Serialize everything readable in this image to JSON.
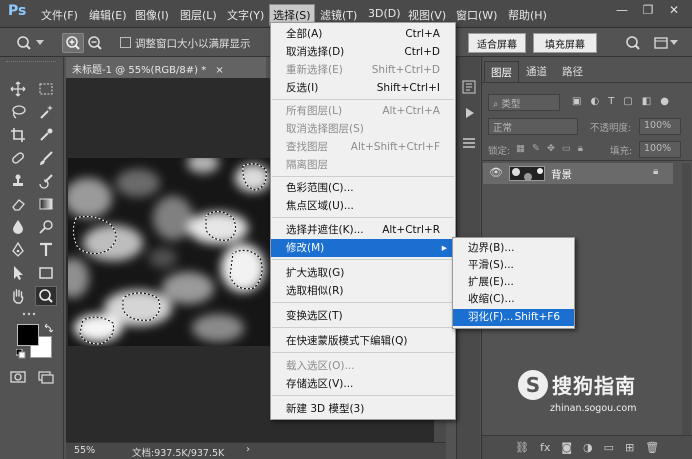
{
  "app": {
    "logo": "Ps"
  },
  "menubar": {
    "items": [
      "文件(F)",
      "编辑(E)",
      "图像(I)",
      "图层(L)",
      "文字(Y)",
      "选择(S)",
      "滤镜(T)",
      "3D(D)",
      "视图(V)",
      "窗口(W)",
      "帮助(H)"
    ],
    "active": "选择(S)",
    "window_controls": {
      "minimize": "—",
      "restore": "❐",
      "close": "✕"
    }
  },
  "options_bar": {
    "resize_window_label": "调整窗口大小以满屏显示",
    "fit_screen_label": "适合屏幕",
    "fill_screen_label": "填充屏幕"
  },
  "document": {
    "tab_title": "未标题-1 @ 55%(RGB/8#) *",
    "tab_close": "×",
    "zoom_level": "55%",
    "doc_info": "文档:937.5K/937.5K"
  },
  "select_menu": {
    "items": [
      {
        "label": "全部(A)",
        "shortcut": "Ctrl+A",
        "disabled": false
      },
      {
        "label": "取消选择(D)",
        "shortcut": "Ctrl+D",
        "disabled": false
      },
      {
        "label": "重新选择(E)",
        "shortcut": "Shift+Ctrl+D",
        "disabled": true
      },
      {
        "label": "反选(I)",
        "shortcut": "Shift+Ctrl+I",
        "disabled": false
      },
      {
        "label": "所有图层(L)",
        "shortcut": "Alt+Ctrl+A",
        "disabled": true
      },
      {
        "label": "取消选择图层(S)",
        "shortcut": "",
        "disabled": true
      },
      {
        "label": "查找图层",
        "shortcut": "Alt+Shift+Ctrl+F",
        "disabled": true
      },
      {
        "label": "隔离图层",
        "shortcut": "",
        "disabled": true
      },
      {
        "label": "色彩范围(C)...",
        "shortcut": "",
        "disabled": false
      },
      {
        "label": "焦点区域(U)...",
        "shortcut": "",
        "disabled": false
      },
      {
        "label": "选择并遮住(K)...",
        "shortcut": "Alt+Ctrl+R",
        "disabled": false
      },
      {
        "label": "修改(M)",
        "shortcut": "",
        "disabled": false,
        "submenu": true,
        "highlighted": true
      },
      {
        "label": "扩大选取(G)",
        "shortcut": "",
        "disabled": false
      },
      {
        "label": "选取相似(R)",
        "shortcut": "",
        "disabled": false
      },
      {
        "label": "变换选区(T)",
        "shortcut": "",
        "disabled": false
      },
      {
        "label": "在快速蒙版模式下编辑(Q)",
        "shortcut": "",
        "disabled": false
      },
      {
        "label": "载入选区(O)...",
        "shortcut": "",
        "disabled": true
      },
      {
        "label": "存储选区(V)...",
        "shortcut": "",
        "disabled": false
      },
      {
        "label": "新建 3D 模型(3)",
        "shortcut": "",
        "disabled": false
      }
    ]
  },
  "modify_submenu": {
    "items": [
      {
        "label": "边界(B)...",
        "shortcut": ""
      },
      {
        "label": "平滑(S)...",
        "shortcut": ""
      },
      {
        "label": "扩展(E)...",
        "shortcut": ""
      },
      {
        "label": "收缩(C)...",
        "shortcut": ""
      },
      {
        "label": "羽化(F)...",
        "shortcut": "Shift+F6",
        "highlighted": true
      }
    ]
  },
  "layers_panel": {
    "tabs": [
      "图层",
      "通道",
      "路径"
    ],
    "active_tab": "图层",
    "filter_kind": "类型",
    "blend_mode": "正常",
    "opacity_label": "不透明度:",
    "opacity_value": "100%",
    "lock_label": "锁定:",
    "fill_label": "填充:",
    "fill_value": "100%",
    "layer_name": "背景"
  },
  "watermark": {
    "text": "搜狗指南",
    "url": "zhinan.sogou.com"
  },
  "colors": {
    "ui_dark": "#535353",
    "menu_bg": "#f0f0f0",
    "highlight": "#1a6fd1",
    "ps_blue": "#8ec8ff"
  }
}
